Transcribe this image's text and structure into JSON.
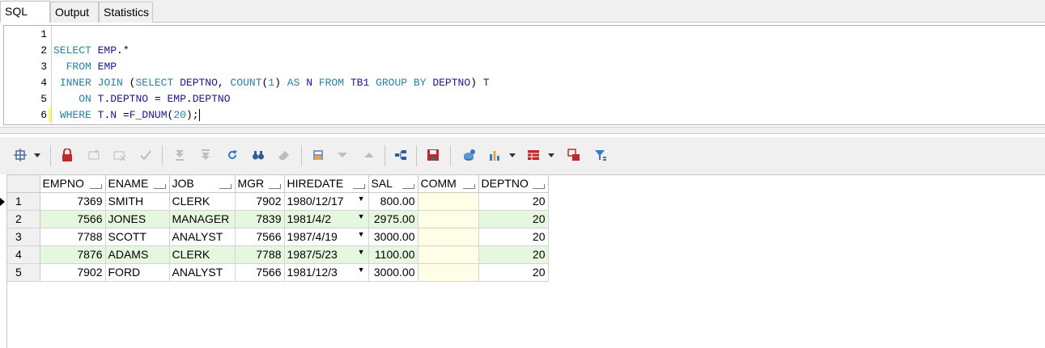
{
  "tabs": [
    {
      "label": "SQL",
      "active": true
    },
    {
      "label": "Output",
      "active": false
    },
    {
      "label": "Statistics",
      "active": false
    }
  ],
  "editor": {
    "line_numbers": [
      "1",
      "2",
      "3",
      "4",
      "5",
      "6"
    ],
    "lines": [
      "",
      "SELECT EMP.*",
      "  FROM EMP",
      " INNER JOIN (SELECT DEPTNO, COUNT(1) AS N FROM TB1 GROUP BY DEPTNO) T",
      "    ON T.DEPTNO = EMP.DEPTNO",
      " WHERE T.N =F_DNUM(20);"
    ]
  },
  "toolbar": {
    "icons": [
      "grid-options-icon",
      "lock-icon",
      "new-record-icon",
      "delete-record-icon",
      "post-icon",
      "first-record-icon",
      "last-record-icon",
      "refresh-icon",
      "find-icon",
      "clear-icon",
      "save-layout-icon",
      "sort-down-icon",
      "sort-up-icon",
      "export-tree-icon",
      "save-icon",
      "query-stats-icon",
      "chart-icon",
      "table-view-icon",
      "compare-icon",
      "filter-icon"
    ]
  },
  "grid": {
    "columns": [
      "EMPNO",
      "ENAME",
      "JOB",
      "MGR",
      "HIREDATE",
      "SAL",
      "COMM",
      "DEPTNO"
    ],
    "rows": [
      {
        "n": "1",
        "EMPNO": "7369",
        "ENAME": "SMITH",
        "JOB": "CLERK",
        "MGR": "7902",
        "HIREDATE": "1980/12/17",
        "SAL": "800.00",
        "COMM": "",
        "DEPTNO": "20"
      },
      {
        "n": "2",
        "EMPNO": "7566",
        "ENAME": "JONES",
        "JOB": "MANAGER",
        "MGR": "7839",
        "HIREDATE": "1981/4/2",
        "SAL": "2975.00",
        "COMM": "",
        "DEPTNO": "20"
      },
      {
        "n": "3",
        "EMPNO": "7788",
        "ENAME": "SCOTT",
        "JOB": "ANALYST",
        "MGR": "7566",
        "HIREDATE": "1987/4/19",
        "SAL": "3000.00",
        "COMM": "",
        "DEPTNO": "20"
      },
      {
        "n": "4",
        "EMPNO": "7876",
        "ENAME": "ADAMS",
        "JOB": "CLERK",
        "MGR": "7788",
        "HIREDATE": "1987/5/23",
        "SAL": "1100.00",
        "COMM": "",
        "DEPTNO": "20"
      },
      {
        "n": "5",
        "EMPNO": "7902",
        "ENAME": "FORD",
        "JOB": "ANALYST",
        "MGR": "7566",
        "HIREDATE": "1981/12/3",
        "SAL": "3000.00",
        "COMM": "",
        "DEPTNO": "20"
      }
    ]
  },
  "colors": {
    "alt_row": "#e6f7e0",
    "comm_col": "#fefde6",
    "keyword": "#2b7fa0",
    "identifier": "#1a1a8c"
  }
}
